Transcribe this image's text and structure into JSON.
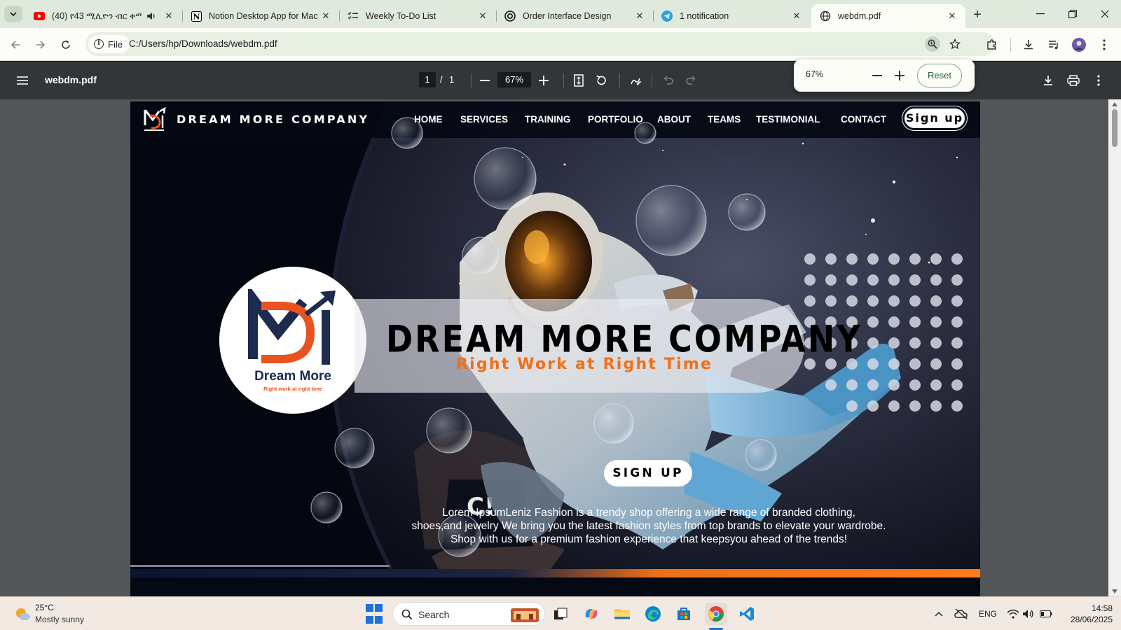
{
  "tabs": [
    {
      "title": "(40) የ43 ሚሊዮን ብር ቀሚስ",
      "icon": "youtube-icon",
      "audio": true
    },
    {
      "title": "Notion Desktop App for Mac",
      "icon": "notion-icon"
    },
    {
      "title": "Weekly To-Do List",
      "icon": "checklist-icon"
    },
    {
      "title": "Order Interface Design",
      "icon": "openai-icon"
    },
    {
      "title": "1 notification",
      "icon": "telegram-icon"
    },
    {
      "title": "webdm.pdf",
      "icon": "globe-icon",
      "active": true
    }
  ],
  "toolbar": {
    "chip_label": "File",
    "url": "C:/Users/hp/Downloads/webdm.pdf"
  },
  "pdf": {
    "filename": "webdm.pdf",
    "page_current": "1",
    "page_sep": "/",
    "page_total": "1",
    "zoom": "67%"
  },
  "zoom_popup": {
    "value": "67%",
    "reset_label": "Reset"
  },
  "site": {
    "brand": "DREAM MORE COMPANY",
    "nav": [
      "HOME",
      "SERVICES",
      "TRAINING",
      "PORTFOLIO",
      "ABOUT",
      "TEAMS",
      "TESTIMONIAL",
      "CONTACT"
    ],
    "signup_label": "Sign up",
    "logo_name": "Dream More",
    "logo_tag": "Right work at right time",
    "hero_title": "DREAM MORE COMPANY",
    "hero_subtitle": "Right Work at Right Time",
    "cta_label": "SIGN UP",
    "hero_desc": [
      "Lorem IpsumLeniz Fashion is a trendy shop offering a wide range of branded clothing,",
      "shoes,and jewelry We bring you the latest fashion styles from top brands to elevate your wardrobe.",
      "Shop with us for a premium fashion experience that keepsyou ahead of the trends!"
    ],
    "colors": {
      "accent": "#f07018",
      "dark": "#050914",
      "logo_navy": "#1d2b4f"
    }
  },
  "taskbar": {
    "weather_temp": "25°C",
    "weather_desc": "Mostly sunny",
    "search_label": "Search",
    "lang": "ENG",
    "time": "14:58",
    "date": "28/06/2025"
  }
}
